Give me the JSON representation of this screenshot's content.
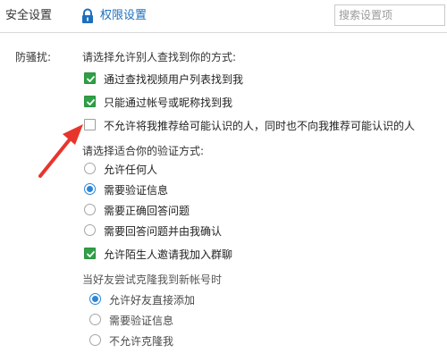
{
  "tabs": {
    "security": "安全设置",
    "permission": "权限设置"
  },
  "search": {
    "placeholder": "搜索设置项"
  },
  "section": {
    "label": "防骚扰:",
    "find_heading": "请选择允许别人查找到你的方式:",
    "find_options": [
      {
        "label": "通过查找视频用户列表找到我",
        "checked": true
      },
      {
        "label": "只能通过帐号或昵称找到我",
        "checked": true
      },
      {
        "label": "不允许将我推荐给可能认识的人，同时也不向我推荐可能认识的人",
        "checked": false
      }
    ],
    "verify_heading": "请选择适合你的验证方式:",
    "verify_options": [
      {
        "label": "允许任何人",
        "selected": false
      },
      {
        "label": "需要验证信息",
        "selected": true
      },
      {
        "label": "需要正确回答问题",
        "selected": false
      },
      {
        "label": "需要回答问题并由我确认",
        "selected": false
      }
    ],
    "group_invite": {
      "label": "允许陌生人邀请我加入群聊",
      "checked": true
    },
    "clone_heading": "当好友尝试克隆我到新帐号时",
    "clone_options": [
      {
        "label": "允许好友直接添加",
        "selected": true
      },
      {
        "label": "需要验证信息",
        "selected": false
      },
      {
        "label": "不允许克隆我",
        "selected": false
      }
    ]
  },
  "colors": {
    "accent_blue": "#1d6fbd",
    "checkbox_green": "#2fa046",
    "radio_blue": "#2b86d6",
    "annotation_red": "#e8352c"
  },
  "icons": {
    "permission_tab": "lock-icon",
    "checkbox_mark": "checkmark-icon",
    "annotation": "red-arrow-icon"
  }
}
